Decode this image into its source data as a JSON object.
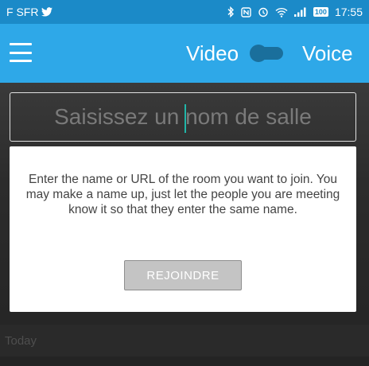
{
  "status_bar": {
    "carrier": "F SFR",
    "time": "17:55",
    "battery": "100",
    "icons": [
      "twitter-icon",
      "bluetooth-icon",
      "nfc-icon",
      "alarm-icon",
      "wifi-icon",
      "signal-icon",
      "battery-icon"
    ]
  },
  "app_bar": {
    "menu_icon": "hamburger-menu-icon",
    "video_label": "Video",
    "voice_label": "Voice",
    "toggle_state": "video"
  },
  "room_input": {
    "placeholder": "Saisissez un nom de salle",
    "value": ""
  },
  "hint": {
    "text": "Enter the name or URL of the room you want to join. You may make a name up, just let the people you are meeting know it so that they enter the same name.",
    "join_button": "REJOINDRE"
  },
  "recent": {
    "section_label": "Today"
  },
  "colors": {
    "status_bar": "#1b8ac8",
    "app_bar": "#2ea8e8",
    "caret": "#21b5a8",
    "join_button": "#c4c4c4"
  }
}
